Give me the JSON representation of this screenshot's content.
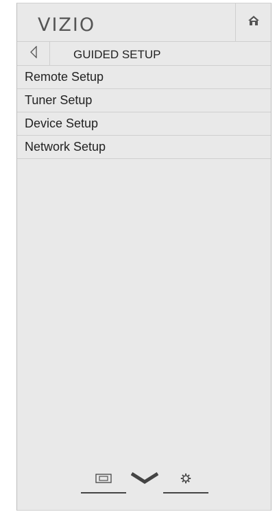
{
  "header": {
    "logo_text": "VIZIO",
    "home_icon": "home-icon"
  },
  "nav": {
    "back_icon": "back-arrow-icon",
    "title": "GUIDED SETUP"
  },
  "menu": {
    "items": [
      {
        "label": "Remote Setup"
      },
      {
        "label": "Tuner Setup"
      },
      {
        "label": "Device Setup"
      },
      {
        "label": "Network Setup"
      }
    ]
  },
  "bottom_bar": {
    "icons": [
      "input-icon",
      "vizio-v-icon",
      "settings-gear-icon"
    ]
  },
  "colors": {
    "panel_bg": "#e9e9e9",
    "divider": "#cfcfcf",
    "text": "#222222",
    "logo": "#555555"
  }
}
